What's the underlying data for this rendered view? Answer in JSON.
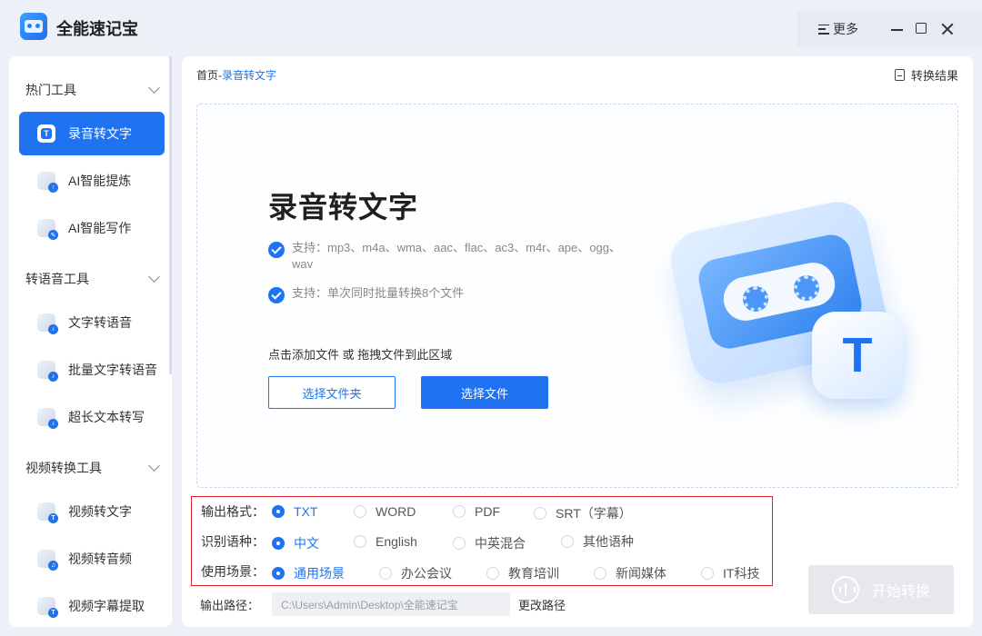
{
  "app": {
    "title": "全能速记宝"
  },
  "titlebar": {
    "more_label": "更多"
  },
  "sidebar": {
    "categories": [
      {
        "label": "热门工具"
      },
      {
        "label": "转语音工具"
      },
      {
        "label": "视频转换工具"
      }
    ],
    "items": [
      {
        "label": "录音转文字",
        "active": true
      },
      {
        "label": "AI智能提炼"
      },
      {
        "label": "AI智能写作"
      },
      {
        "label": "文字转语音"
      },
      {
        "label": "批量文字转语音"
      },
      {
        "label": "超长文本转写"
      },
      {
        "label": "视频转文字"
      },
      {
        "label": "视频转音频"
      },
      {
        "label": "视频字幕提取"
      }
    ]
  },
  "main": {
    "breadcrumb": {
      "home": "首页",
      "separator": "-",
      "current": "录音转文字"
    },
    "result_label": "转换结果",
    "dropzone": {
      "title": "录音转文字",
      "features": [
        "支持：mp3、m4a、wma、aac、flac、ac3、m4r、ape、ogg、wav",
        "支持：单次同时批量转换8个文件"
      ],
      "hint": "点击添加文件 或 拖拽文件到此区域",
      "select_folder": "选择文件夹",
      "select_file": "选择文件",
      "illustration_letter": "T"
    },
    "options": {
      "format": {
        "label": "输出格式：",
        "choices": [
          "TXT",
          "WORD",
          "PDF",
          "SRT（字幕）"
        ],
        "selected": "TXT"
      },
      "language": {
        "label": "识别语种：",
        "choices": [
          "中文",
          "English",
          "中英混合",
          "其他语种"
        ],
        "selected": "中文"
      },
      "scene": {
        "label": "使用场景：",
        "choices": [
          "通用场景",
          "办公会议",
          "教育培训",
          "新闻媒体",
          "IT科技"
        ],
        "selected": "通用场景"
      }
    },
    "output_path": {
      "label": "输出路径：",
      "value": "C:\\Users\\Admin\\Desktop\\全能速记宝",
      "change_label": "更改路径"
    },
    "start_label": "开始转换"
  },
  "colors": {
    "accent": "#1f73f1",
    "highlight_border": "#e0262b",
    "disabled": "#e6e8ec"
  }
}
